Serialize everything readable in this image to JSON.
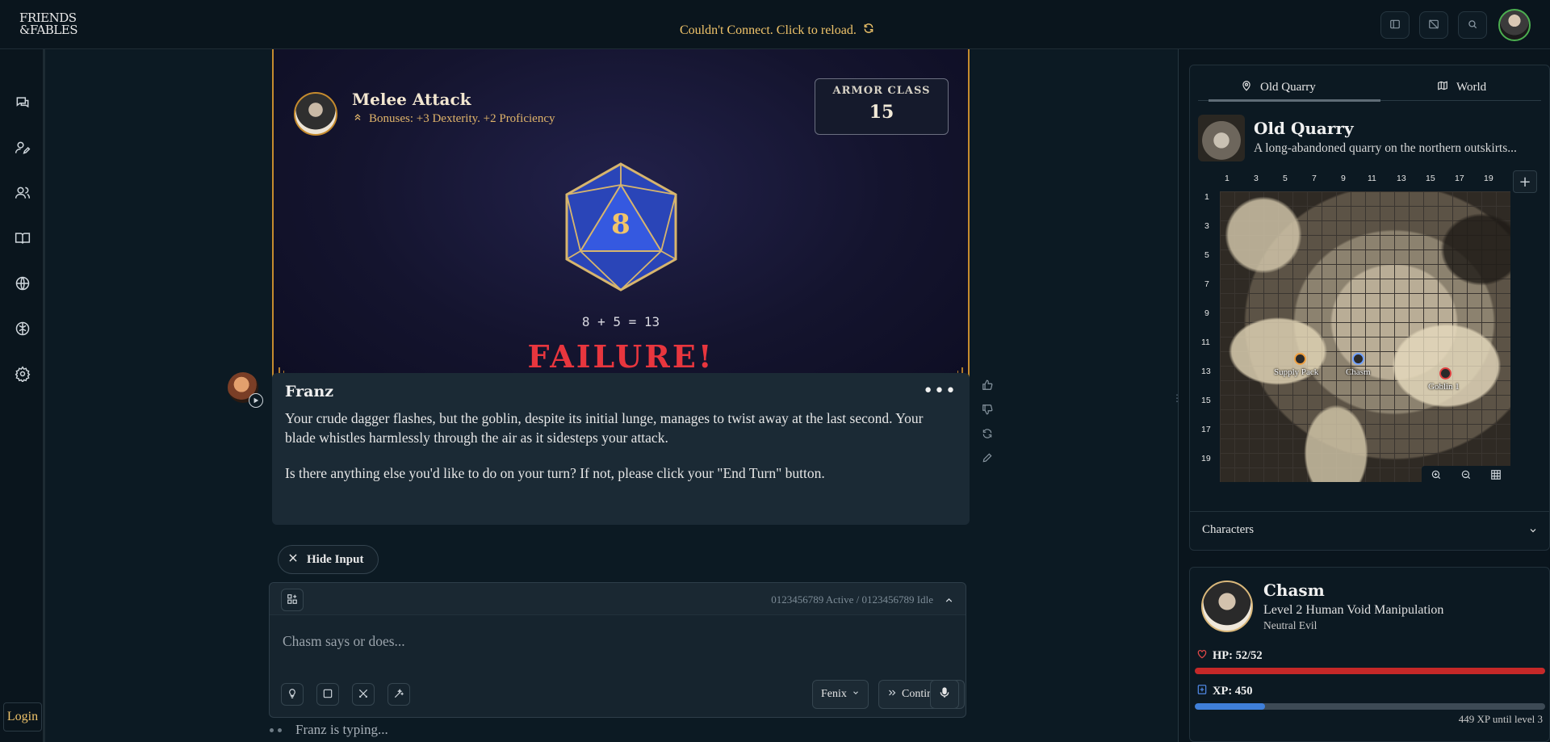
{
  "header": {
    "logo_line1": "FRIENDS",
    "logo_line2": "&FABLES",
    "connection_message": "Couldn't Connect. Click to reload."
  },
  "nav": {
    "login_label": "Login",
    "icons": [
      "chat-icon",
      "character-edit-icon",
      "party-icon",
      "book-icon",
      "globe-icon",
      "brain-icon",
      "settings-icon"
    ]
  },
  "roll": {
    "title": "Melee Attack",
    "bonuses": "Bonuses: +3 Dexterity. +2 Proficiency",
    "armor_class_label": "ARMOR CLASS",
    "armor_class_value": "15",
    "die_value": "8",
    "formula": "8 + 5 = 13",
    "result": "FAILURE!"
  },
  "message": {
    "author": "Franz",
    "paragraph1": "Your crude dagger flashes, but the goblin, despite its initial lunge, manages to twist away at the last second. Your blade whistles harmlessly through the air as it sidesteps your attack.",
    "paragraph2": "Is there anything else you'd like to do on your turn? If not, please click your \"End Turn\" button."
  },
  "composer": {
    "hide_input_label": "Hide Input",
    "status": "0123456789 Active / 0123456789 Idle",
    "placeholder": "Chasm says or does...",
    "voice_select": "Fenix",
    "mode_select": "Continue",
    "typing_text": "Franz is typing..."
  },
  "location": {
    "tab_local": "Old Quarry",
    "tab_world": "World",
    "title": "Old Quarry",
    "description": "A long-abandoned quarry on the northern outskirts...",
    "col_labels": [
      "1",
      "3",
      "5",
      "7",
      "9",
      "11",
      "13",
      "15",
      "17",
      "19"
    ],
    "row_labels": [
      "1",
      "3",
      "5",
      "7",
      "9",
      "11",
      "13",
      "15",
      "17",
      "19"
    ],
    "tokens": [
      {
        "label": "Supply Pack",
        "color": "#f0a040"
      },
      {
        "label": "Chasm",
        "color": "#6fa0ff"
      },
      {
        "label": "Goblin 1",
        "color": "#e04040"
      }
    ],
    "characters_label": "Characters"
  },
  "character": {
    "name": "Chasm",
    "class_line": "Level 2 Human Void Manipulation",
    "alignment": "Neutral Evil",
    "hp_label": "HP: 52/52",
    "hp_fraction": 1.0,
    "xp_label": "XP: 450",
    "xp_fraction": 0.2,
    "xp_hint": "449 XP until level 3"
  },
  "colors": {
    "accent_gold": "#f0c46a",
    "failure_red": "#e8363e",
    "hp_red": "#c62828",
    "xp_blue": "#3f7fd9"
  }
}
